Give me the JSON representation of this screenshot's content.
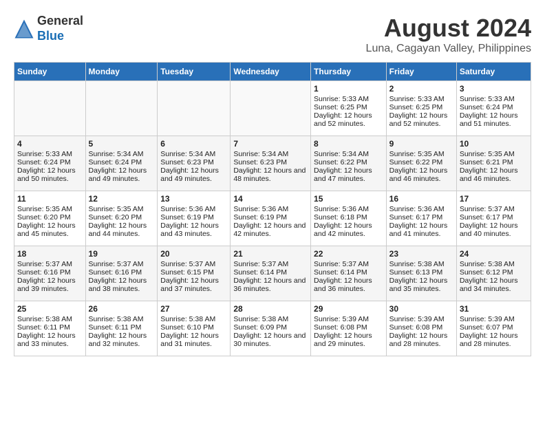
{
  "header": {
    "logo_line1": "General",
    "logo_line2": "Blue",
    "title": "August 2024",
    "subtitle": "Luna, Cagayan Valley, Philippines"
  },
  "calendar": {
    "columns": [
      "Sunday",
      "Monday",
      "Tuesday",
      "Wednesday",
      "Thursday",
      "Friday",
      "Saturday"
    ],
    "weeks": [
      {
        "days": [
          {
            "num": "",
            "empty": true
          },
          {
            "num": "",
            "empty": true
          },
          {
            "num": "",
            "empty": true
          },
          {
            "num": "",
            "empty": true
          },
          {
            "num": "1",
            "sunrise": "5:33 AM",
            "sunset": "6:25 PM",
            "daylight": "12 hours and 52 minutes."
          },
          {
            "num": "2",
            "sunrise": "5:33 AM",
            "sunset": "6:25 PM",
            "daylight": "12 hours and 52 minutes."
          },
          {
            "num": "3",
            "sunrise": "5:33 AM",
            "sunset": "6:24 PM",
            "daylight": "12 hours and 51 minutes."
          }
        ]
      },
      {
        "days": [
          {
            "num": "4",
            "sunrise": "5:33 AM",
            "sunset": "6:24 PM",
            "daylight": "12 hours and 50 minutes."
          },
          {
            "num": "5",
            "sunrise": "5:34 AM",
            "sunset": "6:24 PM",
            "daylight": "12 hours and 49 minutes."
          },
          {
            "num": "6",
            "sunrise": "5:34 AM",
            "sunset": "6:23 PM",
            "daylight": "12 hours and 49 minutes."
          },
          {
            "num": "7",
            "sunrise": "5:34 AM",
            "sunset": "6:23 PM",
            "daylight": "12 hours and 48 minutes."
          },
          {
            "num": "8",
            "sunrise": "5:34 AM",
            "sunset": "6:22 PM",
            "daylight": "12 hours and 47 minutes."
          },
          {
            "num": "9",
            "sunrise": "5:35 AM",
            "sunset": "6:22 PM",
            "daylight": "12 hours and 46 minutes."
          },
          {
            "num": "10",
            "sunrise": "5:35 AM",
            "sunset": "6:21 PM",
            "daylight": "12 hours and 46 minutes."
          }
        ]
      },
      {
        "days": [
          {
            "num": "11",
            "sunrise": "5:35 AM",
            "sunset": "6:20 PM",
            "daylight": "12 hours and 45 minutes."
          },
          {
            "num": "12",
            "sunrise": "5:35 AM",
            "sunset": "6:20 PM",
            "daylight": "12 hours and 44 minutes."
          },
          {
            "num": "13",
            "sunrise": "5:36 AM",
            "sunset": "6:19 PM",
            "daylight": "12 hours and 43 minutes."
          },
          {
            "num": "14",
            "sunrise": "5:36 AM",
            "sunset": "6:19 PM",
            "daylight": "12 hours and 42 minutes."
          },
          {
            "num": "15",
            "sunrise": "5:36 AM",
            "sunset": "6:18 PM",
            "daylight": "12 hours and 42 minutes."
          },
          {
            "num": "16",
            "sunrise": "5:36 AM",
            "sunset": "6:17 PM",
            "daylight": "12 hours and 41 minutes."
          },
          {
            "num": "17",
            "sunrise": "5:37 AM",
            "sunset": "6:17 PM",
            "daylight": "12 hours and 40 minutes."
          }
        ]
      },
      {
        "days": [
          {
            "num": "18",
            "sunrise": "5:37 AM",
            "sunset": "6:16 PM",
            "daylight": "12 hours and 39 minutes."
          },
          {
            "num": "19",
            "sunrise": "5:37 AM",
            "sunset": "6:16 PM",
            "daylight": "12 hours and 38 minutes."
          },
          {
            "num": "20",
            "sunrise": "5:37 AM",
            "sunset": "6:15 PM",
            "daylight": "12 hours and 37 minutes."
          },
          {
            "num": "21",
            "sunrise": "5:37 AM",
            "sunset": "6:14 PM",
            "daylight": "12 hours and 36 minutes."
          },
          {
            "num": "22",
            "sunrise": "5:37 AM",
            "sunset": "6:14 PM",
            "daylight": "12 hours and 36 minutes."
          },
          {
            "num": "23",
            "sunrise": "5:38 AM",
            "sunset": "6:13 PM",
            "daylight": "12 hours and 35 minutes."
          },
          {
            "num": "24",
            "sunrise": "5:38 AM",
            "sunset": "6:12 PM",
            "daylight": "12 hours and 34 minutes."
          }
        ]
      },
      {
        "days": [
          {
            "num": "25",
            "sunrise": "5:38 AM",
            "sunset": "6:11 PM",
            "daylight": "12 hours and 33 minutes."
          },
          {
            "num": "26",
            "sunrise": "5:38 AM",
            "sunset": "6:11 PM",
            "daylight": "12 hours and 32 minutes."
          },
          {
            "num": "27",
            "sunrise": "5:38 AM",
            "sunset": "6:10 PM",
            "daylight": "12 hours and 31 minutes."
          },
          {
            "num": "28",
            "sunrise": "5:38 AM",
            "sunset": "6:09 PM",
            "daylight": "12 hours and 30 minutes."
          },
          {
            "num": "29",
            "sunrise": "5:39 AM",
            "sunset": "6:08 PM",
            "daylight": "12 hours and 29 minutes."
          },
          {
            "num": "30",
            "sunrise": "5:39 AM",
            "sunset": "6:08 PM",
            "daylight": "12 hours and 28 minutes."
          },
          {
            "num": "31",
            "sunrise": "5:39 AM",
            "sunset": "6:07 PM",
            "daylight": "12 hours and 28 minutes."
          }
        ]
      }
    ]
  }
}
